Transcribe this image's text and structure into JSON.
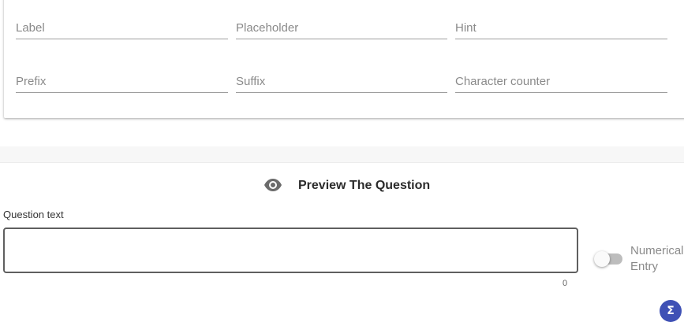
{
  "settings_form": {
    "label_placeholder": "Label",
    "placeholder_placeholder": "Placeholder",
    "hint_placeholder": "Hint",
    "prefix_placeholder": "Prefix",
    "suffix_placeholder": "Suffix",
    "character_counter_placeholder": "Character counter"
  },
  "preview": {
    "icon": "eye-icon",
    "title": "Preview The Question",
    "question_label": "Question text",
    "question_value": "",
    "char_count": "0",
    "toggle_label_line1": "Numerical",
    "toggle_label_line2": "Entry",
    "toggle_on": false,
    "sigma_symbol": "Σ"
  },
  "colors": {
    "accent": "#3f51b5",
    "underline": "#9e9e9e",
    "toggle_track": "#bdbdbd"
  }
}
